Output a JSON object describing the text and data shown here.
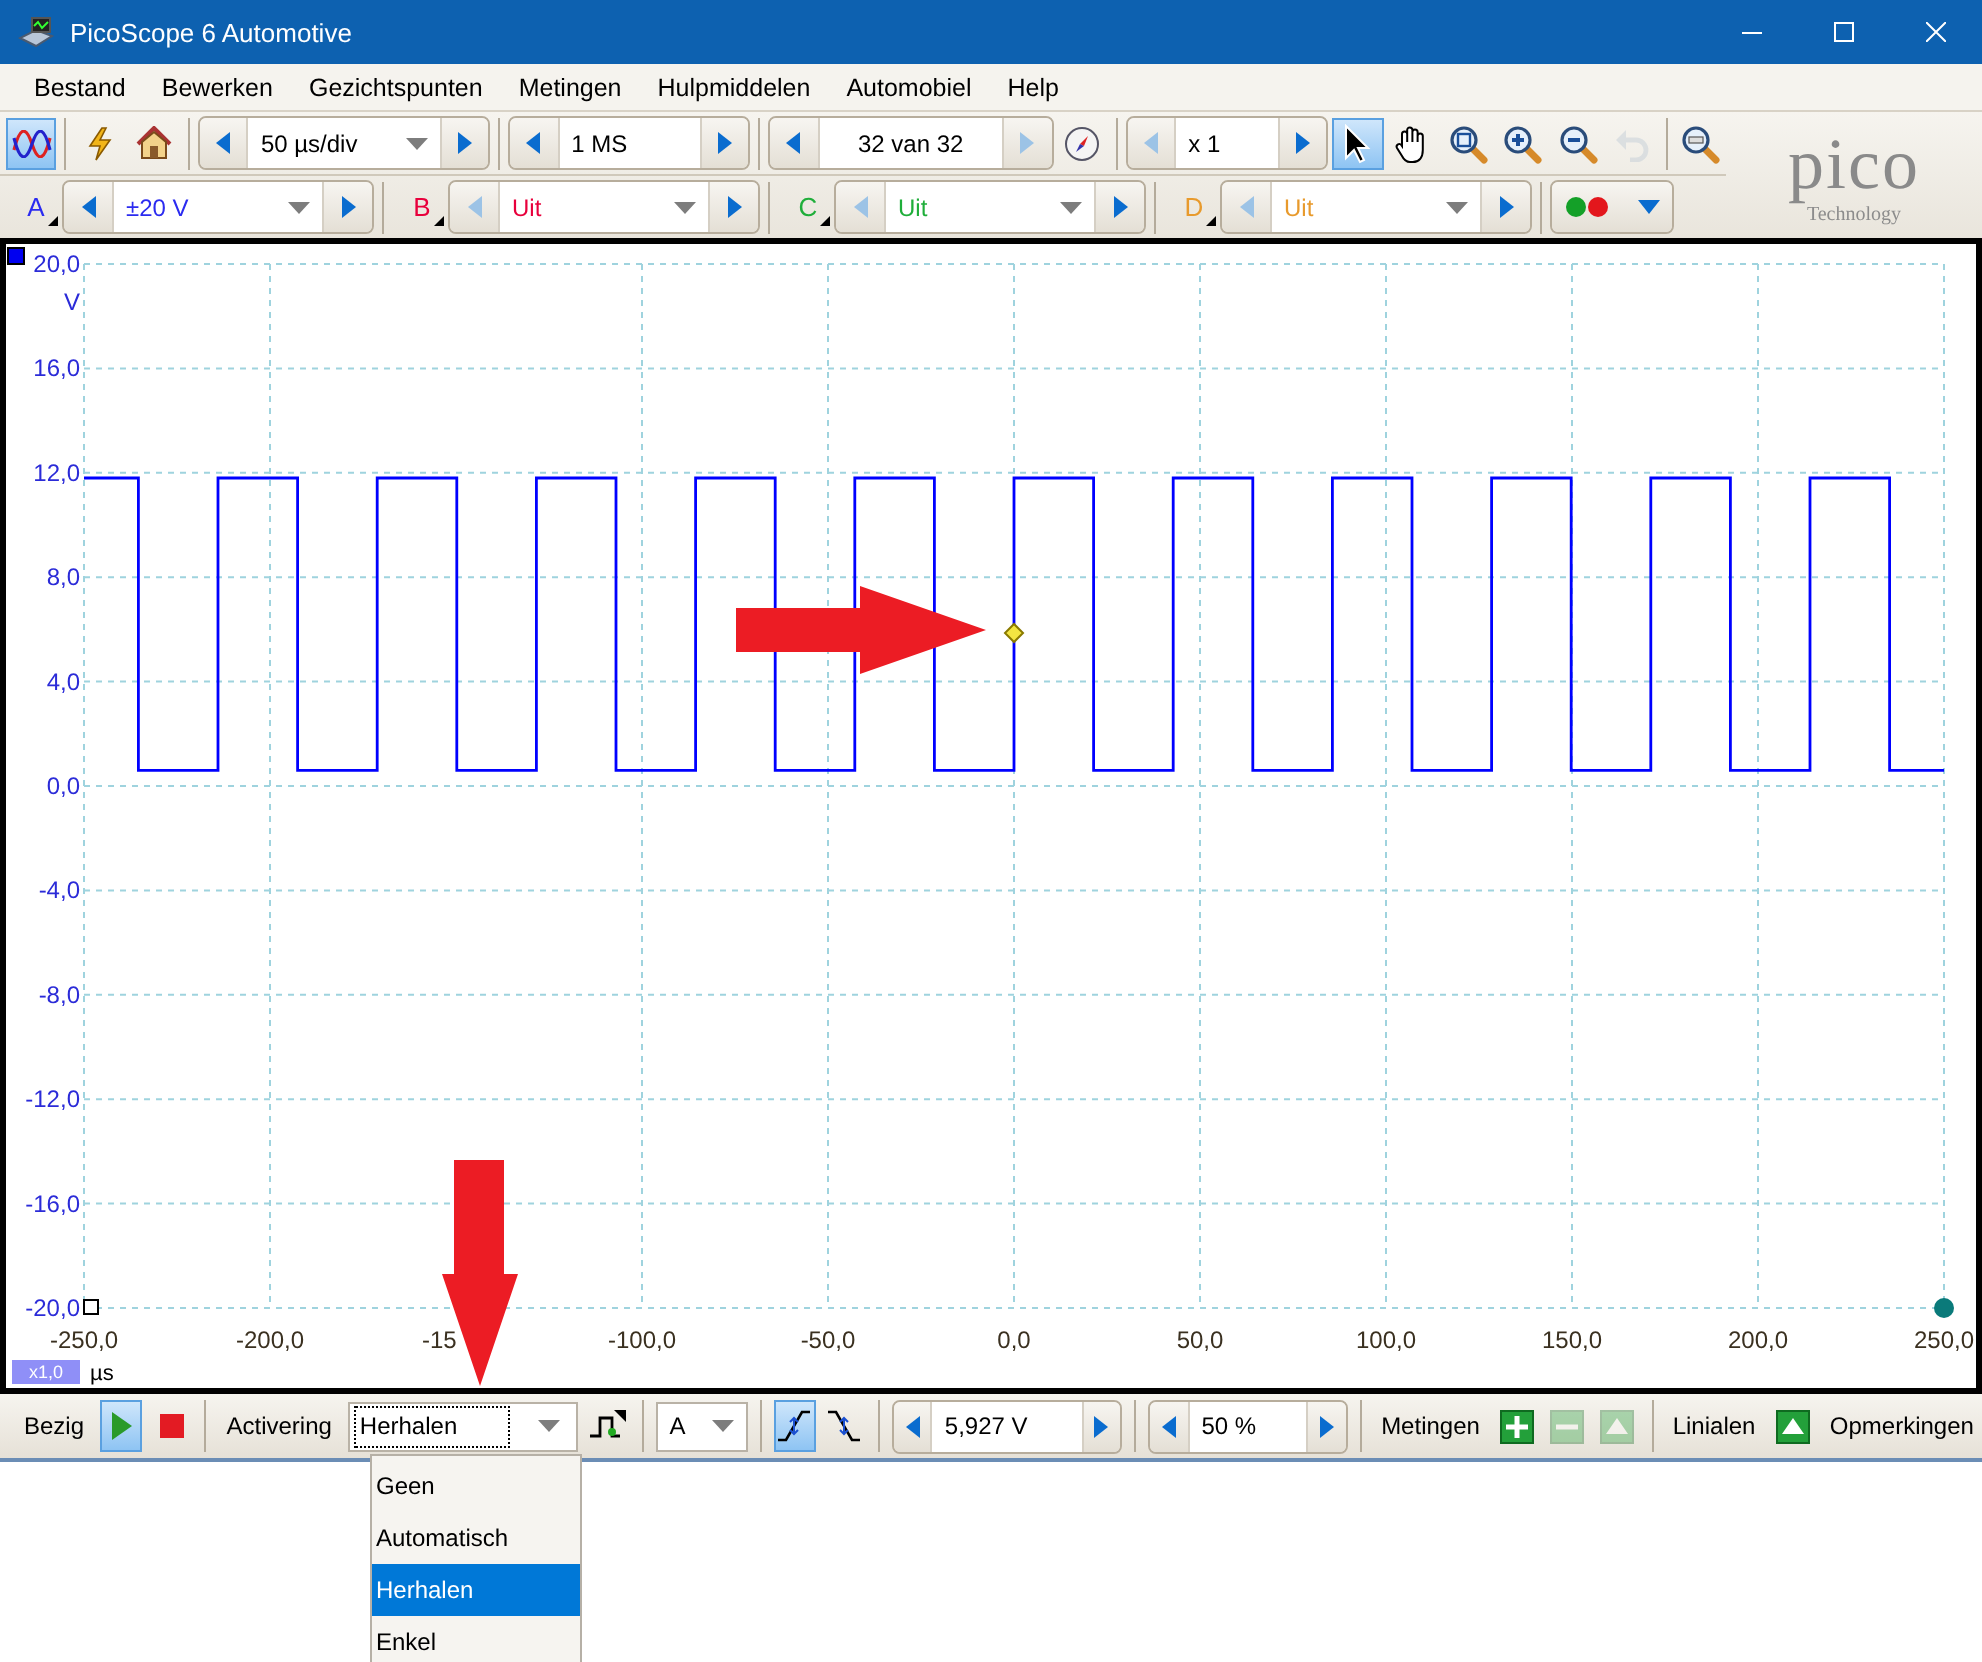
{
  "window": {
    "title": "PicoScope 6 Automotive"
  },
  "menu": [
    "Bestand",
    "Bewerken",
    "Gezichtspunten",
    "Metingen",
    "Hulpmiddelen",
    "Automobiel",
    "Help"
  ],
  "toolbar": {
    "scope_mode": {
      "selected": true
    },
    "timebase": {
      "value": "50 µs/div",
      "prev_disabled": false,
      "next_disabled": false
    },
    "samples": {
      "value": "1 MS",
      "prev_disabled": false,
      "next_disabled": false
    },
    "buffer": {
      "value": "32 van 32",
      "prev_disabled": false,
      "next_disabled": true
    },
    "zoom": {
      "value": "x 1",
      "prev_disabled": true,
      "next_disabled": false
    },
    "tools": [
      {
        "kind": "pointer",
        "selected": true,
        "disabled": false
      },
      {
        "kind": "hand",
        "selected": false,
        "disabled": false
      },
      {
        "kind": "zoom_area",
        "selected": false,
        "disabled": false
      },
      {
        "kind": "zoom_in",
        "selected": false,
        "disabled": false
      },
      {
        "kind": "zoom_out",
        "selected": false,
        "disabled": false
      },
      {
        "kind": "undo",
        "selected": false,
        "disabled": true
      },
      {
        "kind": "zoom_fit",
        "selected": false,
        "disabled": false
      }
    ]
  },
  "logo": {
    "name": "pico",
    "tagline": "Technology"
  },
  "channels": [
    {
      "label": "A",
      "value": "±20 V",
      "color": "#2b2bf0",
      "prev_disabled": false,
      "next_disabled": false
    },
    {
      "label": "B",
      "value": "Uit",
      "color": "#e8003c",
      "prev_disabled": true,
      "next_disabled": false
    },
    {
      "label": "C",
      "value": "Uit",
      "color": "#1fae3a",
      "prev_disabled": true,
      "next_disabled": false
    },
    {
      "label": "D",
      "value": "Uit",
      "color": "#e89a2c",
      "prev_disabled": true,
      "next_disabled": false
    }
  ],
  "scope": {
    "x_zoom": "x1,0",
    "covered_tick_label": "-15",
    "chart_data": {
      "type": "line",
      "xlabel": "µs",
      "ylabel": "V",
      "xlim": [
        -250,
        250
      ],
      "ylim": [
        -20,
        20
      ],
      "xticks": [
        {
          "value": -250,
          "label": "-250,0"
        },
        {
          "value": -200,
          "label": "-200,0"
        },
        {
          "value": -100,
          "label": "-100,0"
        },
        {
          "value": -50,
          "label": "-50,0"
        },
        {
          "value": 0,
          "label": "0,0"
        },
        {
          "value": 50,
          "label": "50,0"
        },
        {
          "value": 100,
          "label": "100,0"
        },
        {
          "value": 150,
          "label": "150,0"
        },
        {
          "value": 200,
          "label": "200,0"
        },
        {
          "value": 250,
          "label": "250,0"
        }
      ],
      "yticks": [
        {
          "value": 20,
          "label": "20,0"
        },
        {
          "value": 16,
          "label": "16,0"
        },
        {
          "value": 12,
          "label": "12,0"
        },
        {
          "value": 8,
          "label": "8,0"
        },
        {
          "value": 4,
          "label": "4,0"
        },
        {
          "value": 0,
          "label": "0,0"
        },
        {
          "value": -4,
          "label": "-4,0"
        },
        {
          "value": -8,
          "label": "-8,0"
        },
        {
          "value": -12,
          "label": "-12,0"
        },
        {
          "value": -16,
          "label": "-16,0"
        },
        {
          "value": -20,
          "label": "-20,0"
        }
      ],
      "x": [
        -250,
        -235.4,
        -235.4,
        -214,
        -214,
        -192.6,
        -192.6,
        -171.2,
        -171.2,
        -149.8,
        -149.8,
        -128.4,
        -128.4,
        -107,
        -107,
        -85.6,
        -85.6,
        -64.2,
        -64.2,
        -42.8,
        -42.8,
        -21.4,
        -21.4,
        0,
        0,
        21.4,
        21.4,
        42.8,
        42.8,
        64.2,
        64.2,
        85.6,
        85.6,
        107,
        107,
        128.4,
        128.4,
        149.8,
        149.8,
        171.2,
        171.2,
        192.6,
        192.6,
        214,
        214,
        235.4,
        235.4,
        250
      ],
      "series": [
        {
          "color": "#0000ff",
          "values": [
            11.8,
            11.8,
            0.6,
            0.6,
            11.8,
            11.8,
            0.6,
            0.6,
            11.8,
            11.8,
            0.6,
            0.6,
            11.8,
            11.8,
            0.6,
            0.6,
            11.8,
            11.8,
            0.6,
            0.6,
            11.8,
            11.8,
            0.6,
            0.6,
            11.8,
            11.8,
            0.6,
            0.6,
            11.8,
            11.8,
            0.6,
            0.6,
            11.8,
            11.8,
            0.6,
            0.6,
            11.8,
            11.8,
            0.6,
            0.6,
            11.8,
            11.8,
            0.6,
            0.6,
            11.8,
            11.8,
            0.6,
            0.6
          ]
        }
      ],
      "grid": true
    }
  },
  "bottom_bar": {
    "status": "Bezig",
    "run": {
      "selected": true
    },
    "stop": {
      "selected": false
    },
    "trigger_label": "Activering",
    "trigger_mode": "Herhalen",
    "trigger_source": "A",
    "edges": [
      {
        "kind": "rising",
        "selected": true
      },
      {
        "kind": "falling",
        "selected": false
      }
    ],
    "level": {
      "value": "5,927 V",
      "prev_disabled": false,
      "next_disabled": false
    },
    "pretrigger": {
      "value": "50 %",
      "prev_disabled": false,
      "next_disabled": false
    },
    "measurements_label": "Metingen",
    "measurement_buttons": [
      {
        "kind": "add",
        "disabled": false
      },
      {
        "kind": "remove",
        "disabled": true
      },
      {
        "kind": "edit",
        "disabled": true
      }
    ],
    "rulers_label": "Linialen",
    "notes_label": "Opmerkingen"
  },
  "trigger_menu": [
    {
      "label": "Geen",
      "selected": false
    },
    {
      "label": "Automatisch",
      "selected": false
    },
    {
      "label": "Herhalen",
      "selected": true
    },
    {
      "label": "Enkel",
      "selected": false
    }
  ]
}
